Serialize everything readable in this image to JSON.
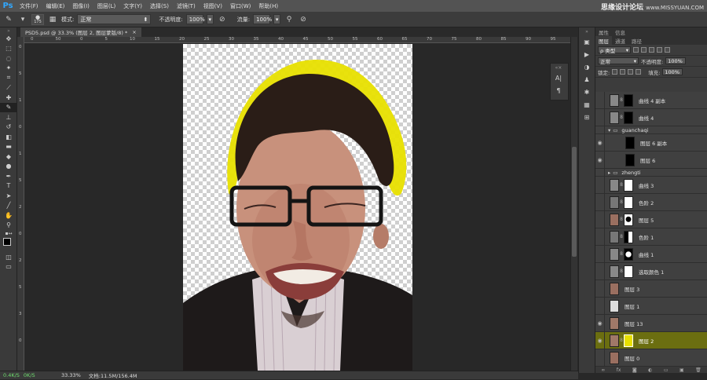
{
  "app": {
    "logo": "Ps"
  },
  "menu": [
    "文件(F)",
    "编辑(E)",
    "图像(I)",
    "图层(L)",
    "文字(Y)",
    "选择(S)",
    "滤镜(T)",
    "视图(V)",
    "窗口(W)",
    "帮助(H)"
  ],
  "watermark": {
    "title": "思缘设计论坛",
    "site": "www.MISSYUAN.COM"
  },
  "options": {
    "brush_size": "175",
    "mode_label": "模式:",
    "mode_value": "正常",
    "opacity_label": "不透明度:",
    "opacity_value": "100%",
    "flow_label": "流量:",
    "flow_value": "100%"
  },
  "document_tab": {
    "label": "PSD5.psd @ 33.3% (图层 2, 图层蒙版/8) *",
    "close": "×"
  },
  "ruler_top": [
    "0",
    "50",
    "0",
    "5",
    "10",
    "15",
    "20",
    "25",
    "30",
    "35",
    "40",
    "45",
    "50",
    "55",
    "60",
    "65",
    "70",
    "75",
    "80",
    "85",
    "90",
    "95"
  ],
  "ruler_left": [
    "0",
    "5",
    "1",
    "0",
    "1",
    "5",
    "2",
    "0",
    "2",
    "5",
    "3",
    "0"
  ],
  "layers_panel": {
    "tabs_top": [
      "属性",
      "信息"
    ],
    "tabs": [
      "图层",
      "通道",
      "路径"
    ],
    "filter": "ρ 类型",
    "blend_mode": "正常",
    "opacity_label": "不透明度:",
    "opacity_value": "100%",
    "lock_label": "锁定:",
    "fill_label": "填充:",
    "fill_value": "100%",
    "layers": [
      {
        "name": "曲线 4 副本"
      },
      {
        "name": "曲线 4"
      },
      {
        "name": "guanchaqi"
      },
      {
        "name": "图层 6 副本"
      },
      {
        "name": "图层 6"
      },
      {
        "name": "zhengti"
      },
      {
        "name": "曲线 3"
      },
      {
        "name": "色阶 2"
      },
      {
        "name": "图层 5"
      },
      {
        "name": "色阶 1"
      },
      {
        "name": "曲线 1"
      },
      {
        "name": "选取颜色 1"
      },
      {
        "name": "图层 3"
      },
      {
        "name": "图层 1"
      },
      {
        "name": "图层 13"
      },
      {
        "name": "图层 2"
      },
      {
        "name": "图层 0"
      }
    ]
  },
  "status": {
    "net_up": "0.4K/S",
    "net_down": "0K/S",
    "zoom": "33.33%",
    "doc": "文档:11.5M/156.4M"
  },
  "colors": {
    "accent_layer": "#6b6e10",
    "mask_yellow": "#e8e000"
  }
}
